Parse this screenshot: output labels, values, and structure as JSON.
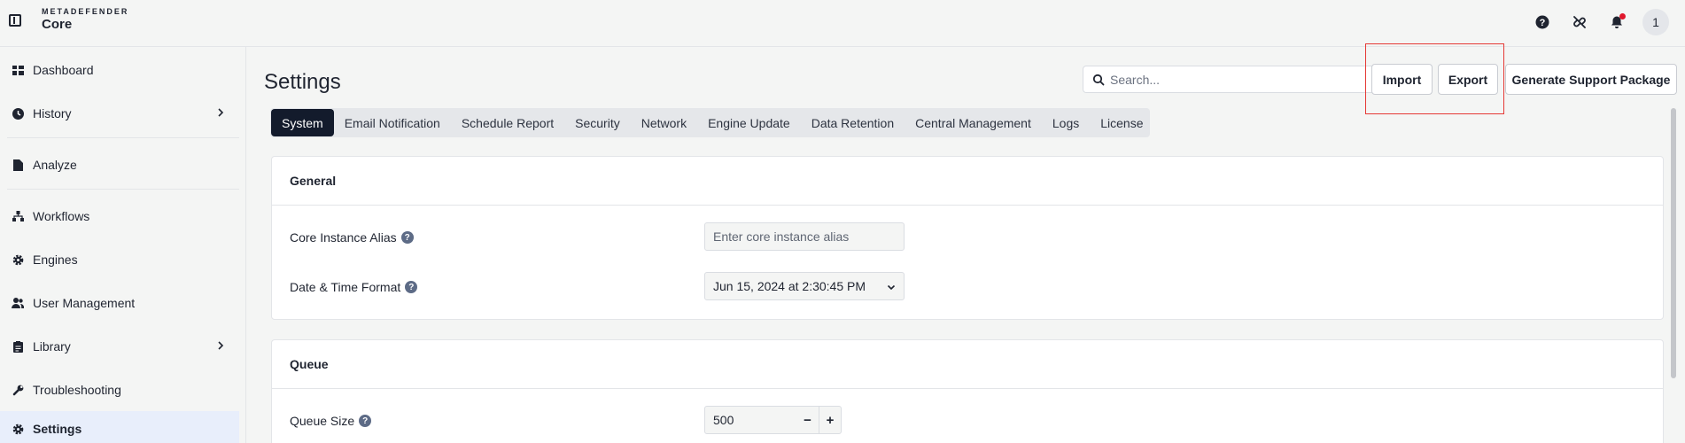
{
  "brand": {
    "top": "METADEFENDER",
    "bottom": "Core"
  },
  "header": {
    "avatar_initial": "1"
  },
  "sidebar": {
    "items": [
      {
        "label": "Dashboard"
      },
      {
        "label": "History"
      },
      {
        "label": "Analyze"
      },
      {
        "label": "Workflows"
      },
      {
        "label": "Engines"
      },
      {
        "label": "User Management"
      },
      {
        "label": "Library"
      },
      {
        "label": "Troubleshooting"
      },
      {
        "label": "Settings"
      }
    ]
  },
  "page": {
    "title": "Settings"
  },
  "search": {
    "placeholder": "Search..."
  },
  "actions": {
    "import": "Import",
    "export": "Export",
    "support": "Generate Support Package"
  },
  "tabs": [
    "System",
    "Email Notification",
    "Schedule Report",
    "Security",
    "Network",
    "Engine Update",
    "Data Retention",
    "Central Management",
    "Logs",
    "License"
  ],
  "general": {
    "title": "General",
    "alias_label": "Core Instance Alias",
    "alias_placeholder": "Enter core instance alias",
    "datetime_label": "Date & Time Format",
    "datetime_value": "Jun 15, 2024 at 2:30:45 PM"
  },
  "queue": {
    "title": "Queue",
    "size_label": "Queue Size",
    "size_value": "500",
    "minus": "−",
    "plus": "+"
  },
  "colors": {
    "active_tab": "#131b2c",
    "active_nav": "#e8eefb",
    "highlight": "#e53935",
    "notification": "#e0182d"
  }
}
